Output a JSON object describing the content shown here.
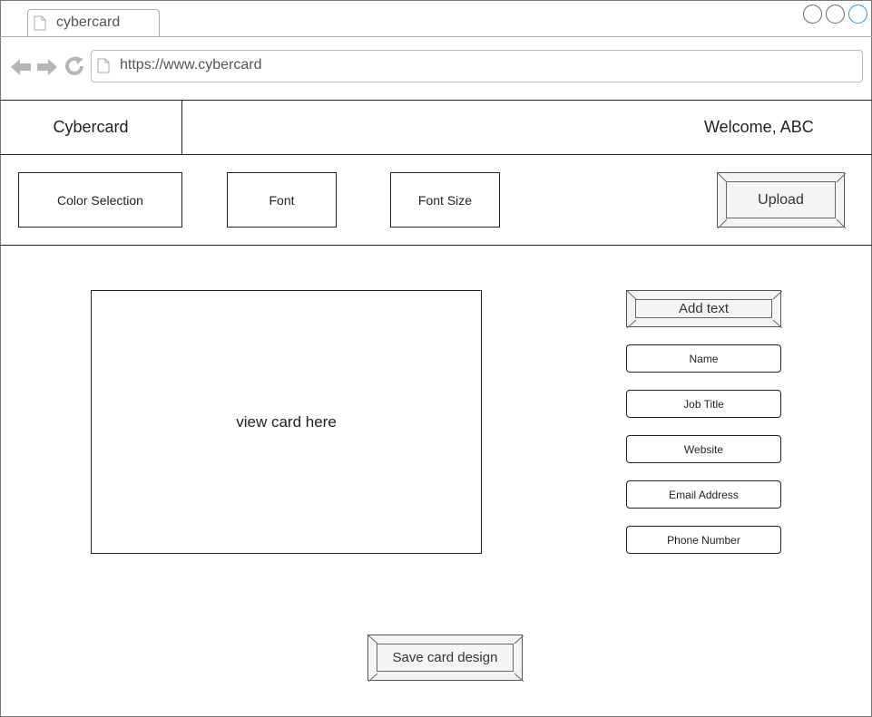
{
  "browser": {
    "tab_title": "cybercard",
    "url": "https://www.cybercard"
  },
  "header": {
    "brand": "Cybercard",
    "welcome": "Welcome, ABC"
  },
  "toolbar": {
    "color_selection": "Color Selection",
    "font": "Font",
    "font_size": "Font Size",
    "upload": "Upload"
  },
  "main": {
    "card_preview": "view card here",
    "add_text": "Add text",
    "fields": [
      "Name",
      "Job Title",
      "Website",
      "Email Address",
      "Phone Number"
    ],
    "save_button": "Save card design"
  },
  "colors": {
    "window_circle_active": "#1a9bd7",
    "border": "#222222",
    "button_fill": "#f4f4f4"
  },
  "icons": [
    "page-icon",
    "back-arrow-icon",
    "forward-arrow-icon",
    "reload-icon"
  ]
}
